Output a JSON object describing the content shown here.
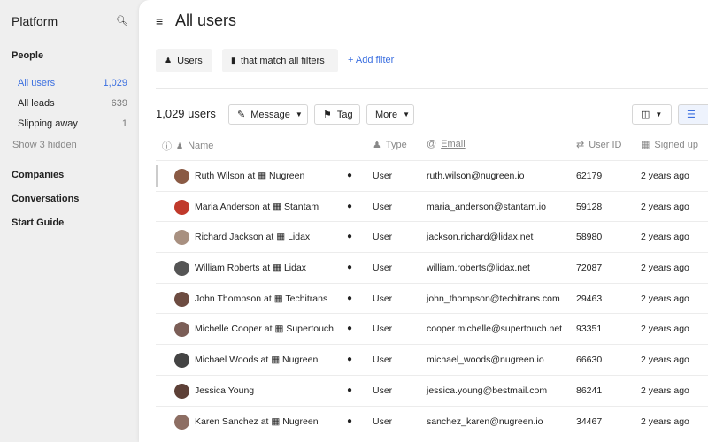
{
  "sidebar": {
    "brand": "Platform",
    "people": "People",
    "nav": [
      {
        "label": "All users",
        "count": "1,029"
      },
      {
        "label": "All leads",
        "count": "639"
      },
      {
        "label": "Slipping away",
        "count": "1"
      }
    ],
    "show_hidden": "Show 3 hidden",
    "sections": [
      "Companies",
      "Conversations",
      "Start Guide"
    ]
  },
  "header": {
    "title": "All users"
  },
  "filters": {
    "users": "Users",
    "match": "that match all filters",
    "add": "+ Add filter"
  },
  "toolbar": {
    "count": "1,029 users",
    "message": "Message",
    "tag": "Tag",
    "more": "More"
  },
  "columns": {
    "name": "Name",
    "type": "Type",
    "email": "Email",
    "user_id": "User ID",
    "signed_up": "Signed up"
  },
  "rows": [
    {
      "name": "Ruth Wilson at",
      "company": "Nugreen",
      "type": "User",
      "email": "ruth.wilson@nugreen.io",
      "id": "62179",
      "signed": "2 years ago"
    },
    {
      "name": "Maria Anderson at",
      "company": "Stantam",
      "type": "User",
      "email": "maria_anderson@stantam.io",
      "id": "59128",
      "signed": "2 years ago"
    },
    {
      "name": "Richard Jackson at",
      "company": "Lidax",
      "type": "User",
      "email": "jackson.richard@lidax.net",
      "id": "58980",
      "signed": "2 years ago"
    },
    {
      "name": "William Roberts at",
      "company": "Lidax",
      "type": "User",
      "email": "william.roberts@lidax.net",
      "id": "72087",
      "signed": "2 years ago"
    },
    {
      "name": "John Thompson at",
      "company": "Techitrans",
      "type": "User",
      "email": "john_thompson@techitrans.com",
      "id": "29463",
      "signed": "2 years ago"
    },
    {
      "name": "Michelle Cooper at",
      "company": "Supertouch",
      "type": "User",
      "email": "cooper.michelle@supertouch.net",
      "id": "93351",
      "signed": "2 years ago"
    },
    {
      "name": "Michael Woods at",
      "company": "Nugreen",
      "type": "User",
      "email": "michael_woods@nugreen.io",
      "id": "66630",
      "signed": "2 years ago"
    },
    {
      "name": "Jessica Young",
      "company": "",
      "type": "User",
      "email": "jessica.young@bestmail.com",
      "id": "86241",
      "signed": "2 years ago"
    },
    {
      "name": "Karen Sanchez at",
      "company": "Nugreen",
      "type": "User",
      "email": "sanchez_karen@nugreen.io",
      "id": "34467",
      "signed": "2 years ago"
    }
  ]
}
